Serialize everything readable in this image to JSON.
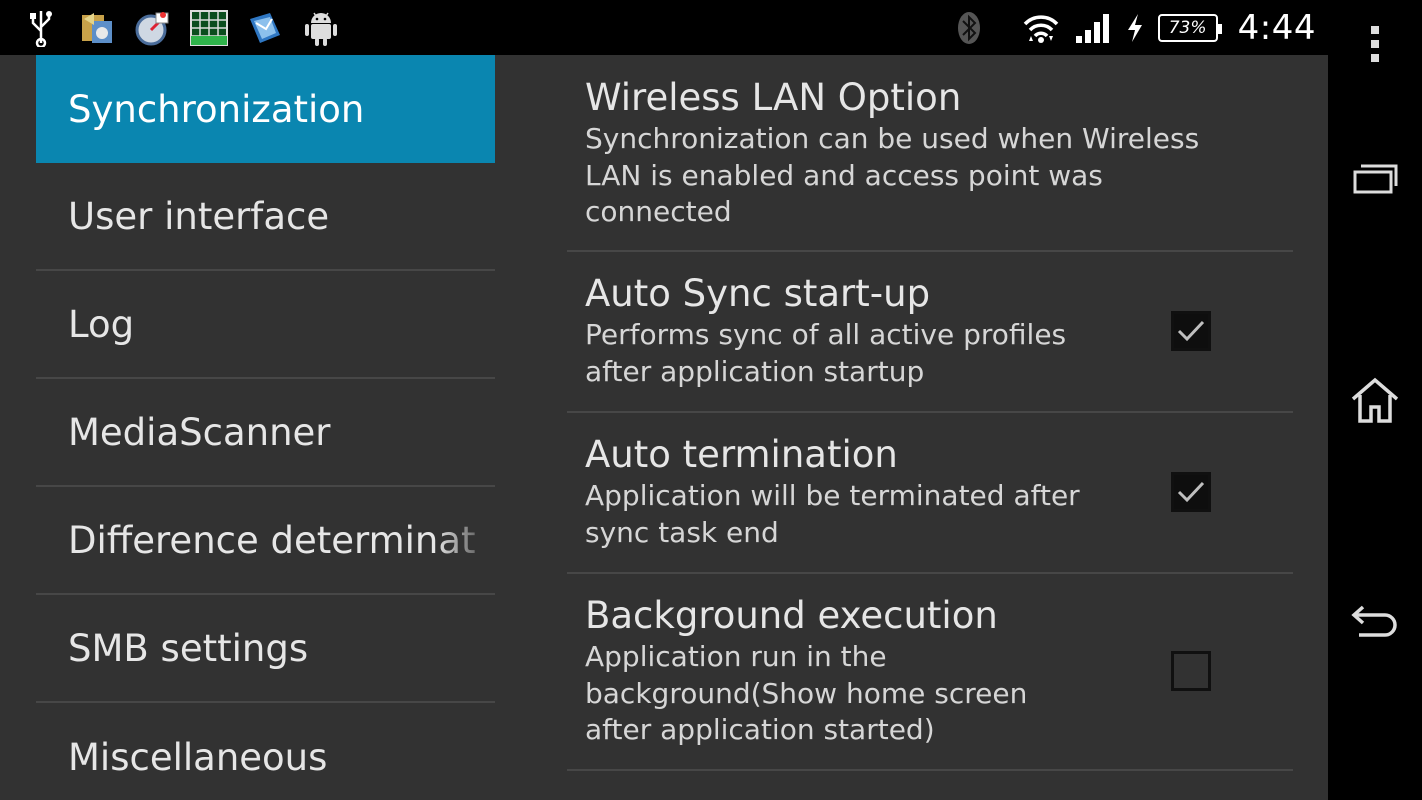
{
  "status_bar": {
    "left_icons": [
      "usb-icon",
      "sync-app-icon",
      "compass-app-icon",
      "grid-app-icon",
      "mail-app-icon",
      "android-icon"
    ],
    "right_icons": [
      "bluetooth-icon",
      "wifi-icon",
      "signal-icon",
      "charging-icon"
    ],
    "battery_percent": "73%",
    "time": "4:44"
  },
  "nav_bar": {
    "buttons": [
      "menu-icon",
      "recent-apps-icon",
      "home-icon",
      "back-icon"
    ]
  },
  "sidebar": {
    "selected_index": 0,
    "accent_color": "#0a86b0",
    "items": [
      {
        "label": "Synchronization"
      },
      {
        "label": "User interface"
      },
      {
        "label": "Log"
      },
      {
        "label": "MediaScanner"
      },
      {
        "label": "Difference determinat"
      },
      {
        "label": "SMB settings"
      },
      {
        "label": "Miscellaneous"
      }
    ]
  },
  "preferences": [
    {
      "title": "Wireless LAN Option",
      "summary": "Synchronization can be used when Wireless LAN is enabled and access point was connected",
      "has_checkbox": false
    },
    {
      "title": "Auto Sync start-up",
      "summary": "Performs sync of all active profiles after application startup",
      "has_checkbox": true,
      "checked": true
    },
    {
      "title": "Auto termination",
      "summary": "Application will be terminated after sync task end",
      "has_checkbox": true,
      "checked": true
    },
    {
      "title": "Background execution",
      "summary": "Application run in the background(Show home screen after application started)",
      "has_checkbox": true,
      "checked": false
    }
  ]
}
